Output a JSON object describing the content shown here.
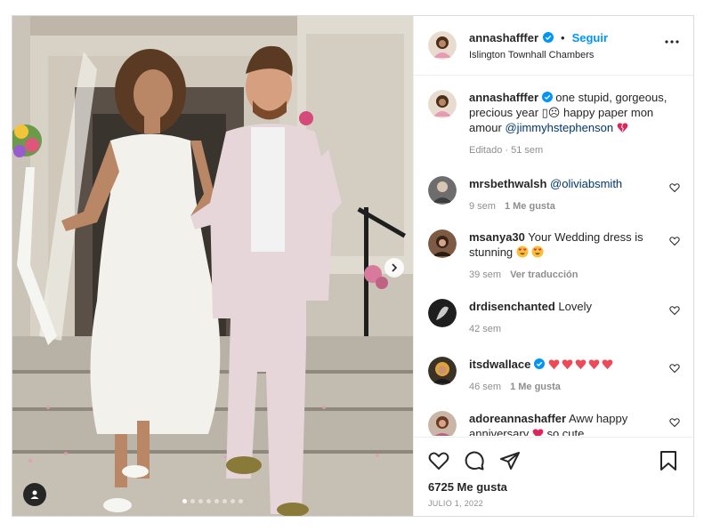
{
  "post": {
    "author": "annashafffer",
    "follow_label": "Seguir",
    "location": "Islington Townhall Chambers",
    "carousel_count": 8,
    "carousel_index": 1
  },
  "caption": {
    "username": "annashafffer",
    "text": "one stupid, gorgeous, precious year ▯☹ happy paper mon amour",
    "mention": "@jimmyhstephenson",
    "meta": "Editado · 51 sem"
  },
  "comments": [
    {
      "username": "mrsbethwalsh",
      "text": "",
      "mention": "@oliviabsmith",
      "time": "9 sem",
      "action": "1 Me gusta",
      "verified": false,
      "emoji": []
    },
    {
      "username": "msanya30",
      "text": "Your Wedding dress is stunning",
      "mention": "",
      "time": "39 sem",
      "action": "Ver traducción",
      "verified": false,
      "emoji": [
        "heart-eyes-emoji",
        "heart-eyes-emoji"
      ]
    },
    {
      "username": "drdisenchanted",
      "text": "Lovely",
      "mention": "",
      "time": "42 sem",
      "action": "",
      "verified": false,
      "emoji": []
    },
    {
      "username": "itsdwallace",
      "text": "",
      "mention": "",
      "time": "46 sem",
      "action": "1 Me gusta",
      "verified": true,
      "emoji": [
        "heart-emoji",
        "heart-emoji",
        "heart-emoji",
        "heart-emoji",
        "heart-emoji"
      ]
    },
    {
      "username": "adoreannashaffer",
      "text": "Aww happy anniversary",
      "text_after": "so cute",
      "mention": "",
      "time": "",
      "action": "",
      "verified": false,
      "emoji": [
        "heart-emoji"
      ]
    }
  ],
  "footer": {
    "likes": "6725 Me gusta",
    "date": "JULIO 1, 2022"
  },
  "colors": {
    "accent": "#0095f6",
    "mention": "#00376b",
    "muted": "#8e8e8e",
    "heart": "#ed4956"
  }
}
